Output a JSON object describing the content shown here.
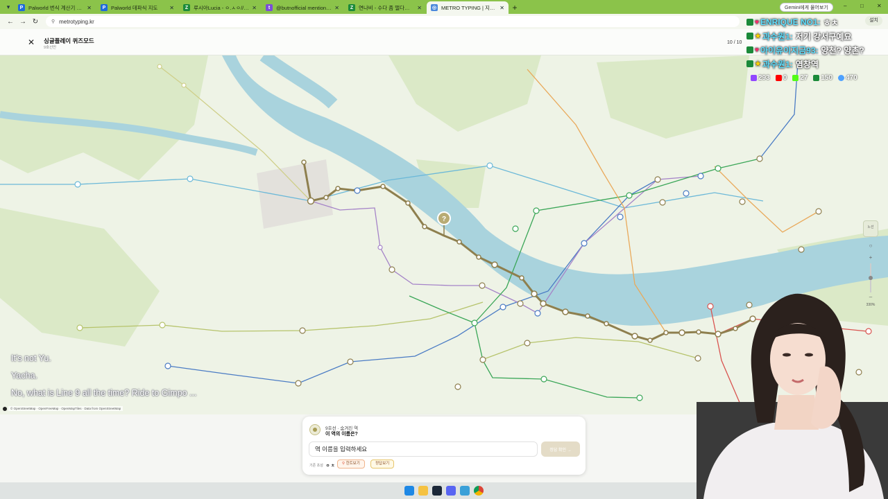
{
  "browser": {
    "tabs": [
      {
        "title": "Palworld 번식 계산기 팔 모드",
        "fav_color": "#1e6adb",
        "fav_glyph": "P"
      },
      {
        "title": "Palworld 데파식 지도",
        "fav_color": "#1e6adb",
        "fav_glyph": "P"
      },
      {
        "title": "루시아Lucia - ㅇ.ㅅㅇ// 상냥카",
        "fav_color": "#1b8a3a",
        "fav_glyph": "Z"
      },
      {
        "title": "@butnofficial mentioned",
        "fav_color": "#7b4dd8",
        "fav_glyph": "t"
      },
      {
        "title": "연나비 - 수다 좀 떨다가 소울~",
        "fav_color": "#1b8a3a",
        "fav_glyph": "Z"
      },
      {
        "title": "METRO TYPING | 지하철 타이~",
        "fav_color": "#4b89dc",
        "fav_glyph": "◎"
      }
    ],
    "url": "metrotyping.kr",
    "install_label": "설치",
    "gemini_label": "Gemini에게 물어보기",
    "window_controls": [
      "–",
      "□",
      "✕"
    ]
  },
  "header": {
    "title": "싱글플레이 퀴즈모드",
    "subtitle": "9호선만",
    "progress": "10 / 10"
  },
  "subtitles": [
    "It's not Yu.",
    "Yacha.",
    "No, what is Line 9 all the time? Ride to Gimpo ..."
  ],
  "attribution": "© OpenStreetMap · OpenFreeMap · OpenMapTiles · Data from OpenStreetMap",
  "map_controls": {
    "layer_label": "노선",
    "zoom": "330%"
  },
  "quiz": {
    "line_info": "9호선 · 숨겨진 역",
    "question": "이 역의 이름은?",
    "input_placeholder": "역 이름을 입력하세요",
    "submit_label": "정답 확인 →",
    "meta_label": "기존 초성",
    "meta_value": "ㅇ ㅊ",
    "hint_label": "힌트보기",
    "answer_label": "정답보기"
  },
  "chat": [
    {
      "name": "ENRIQUE NO1:",
      "msg": "ㅎㅊ"
    },
    {
      "name": "과수원1:",
      "msg": "저기 강서구예요"
    },
    {
      "name": "아이유이지금93:",
      "msg": "양천? 양촌?"
    },
    {
      "name": "과수원1:",
      "msg": "염창역"
    }
  ],
  "stats": [
    {
      "value": "293",
      "color": "#9146ff"
    },
    {
      "value": "0",
      "color": "#ff0000"
    },
    {
      "value": "27",
      "color": "#53fc18"
    },
    {
      "value": "150",
      "color": "#1b8a3a"
    },
    {
      "value": "470",
      "color": "#4ea1ff"
    }
  ],
  "colors": {
    "line9": "#8e7f4e",
    "line1": "#4a7bc4",
    "line2": "#3aa657",
    "line5": "#a583c8",
    "line_airport": "#6bb8d8",
    "line_suin": "#e9a95b",
    "water": "#a9d3dd"
  }
}
